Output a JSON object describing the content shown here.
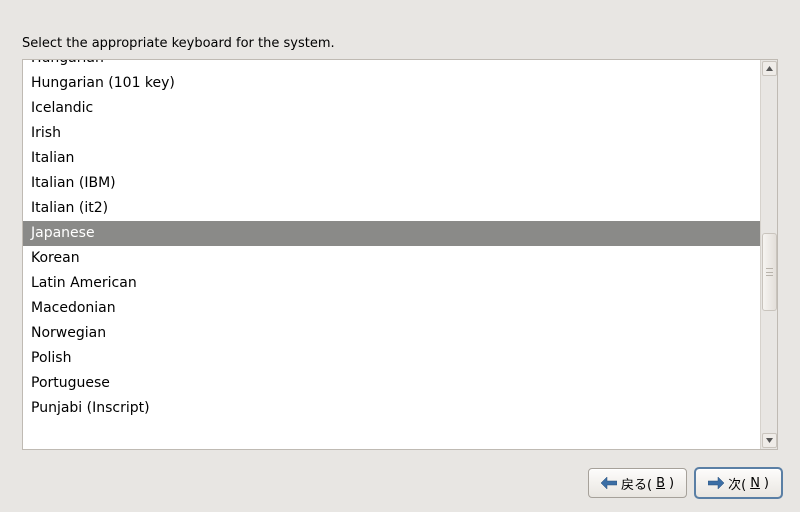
{
  "instruction": "Select the appropriate keyboard for the system.",
  "keyboard_list": {
    "selected_index": 7,
    "items": [
      "Hungarian",
      "Hungarian (101 key)",
      "Icelandic",
      "Irish",
      "Italian",
      "Italian (IBM)",
      "Italian (it2)",
      "Japanese",
      "Korean",
      "Latin American",
      "Macedonian",
      "Norwegian",
      "Polish",
      "Portuguese",
      "Punjabi (Inscript)"
    ]
  },
  "scrollbar": {
    "thumb_top_pct": 44,
    "thumb_height_pct": 22
  },
  "buttons": {
    "back": {
      "label_pre": "戻る(",
      "accel": "B",
      "label_post": ")"
    },
    "next": {
      "label_pre": "次(",
      "accel": "N",
      "label_post": ")"
    }
  },
  "colors": {
    "selection_bg": "#8a8a88",
    "window_bg": "#e8e6e3",
    "outline_focus": "#5a7fa5"
  }
}
